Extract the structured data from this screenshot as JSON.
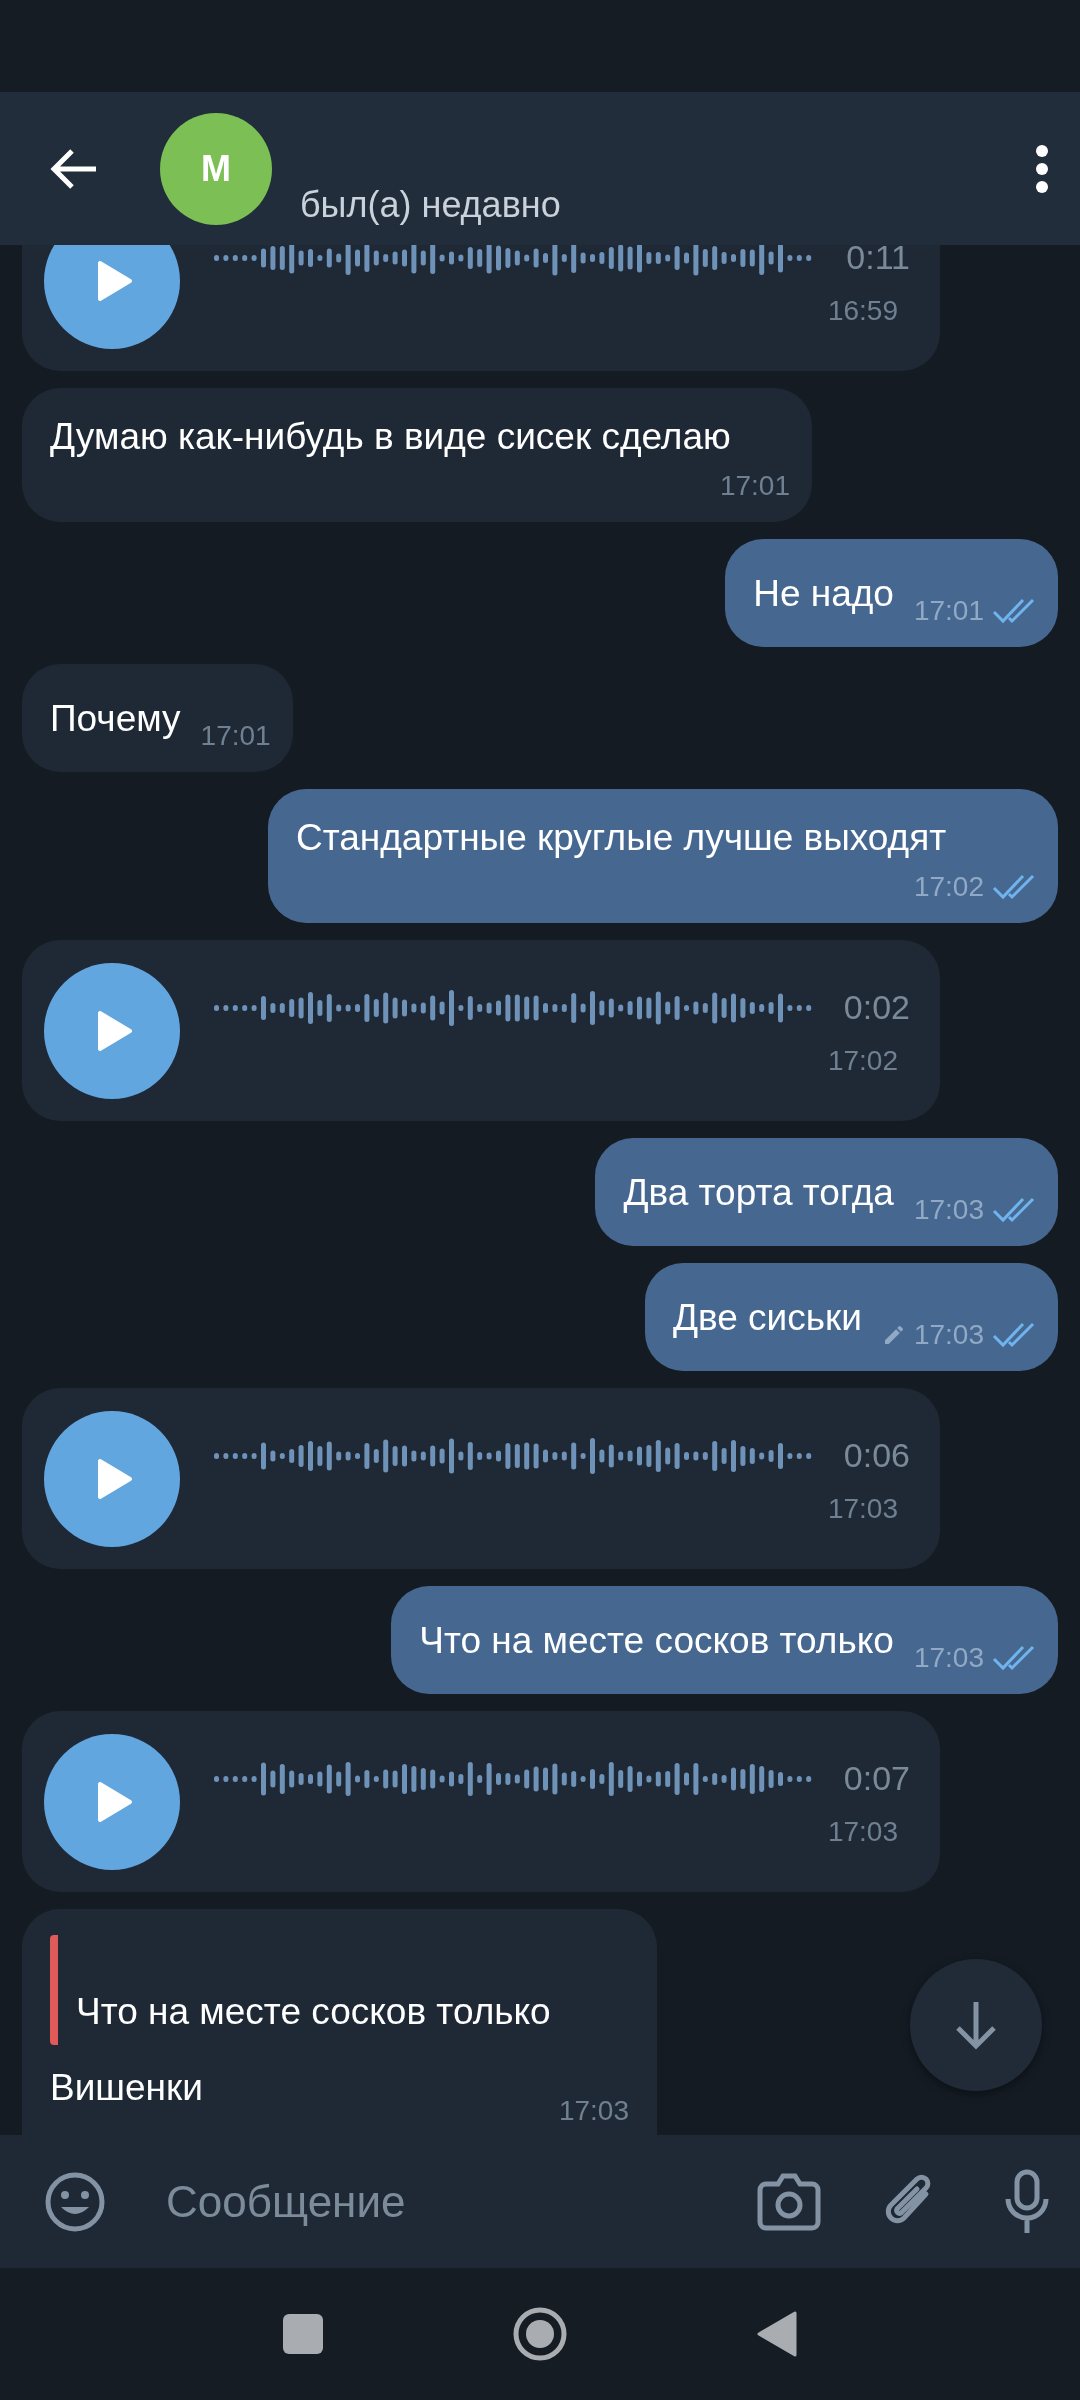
{
  "header": {
    "avatar_letter": "M",
    "status": "был(а) недавно"
  },
  "messages": [
    {
      "kind": "voice",
      "outgoing": false,
      "duration": "0:11",
      "time": "16:59"
    },
    {
      "kind": "text",
      "outgoing": false,
      "text": "Думаю как-нибудь в виде сисек сделаю",
      "time": "17:01"
    },
    {
      "kind": "text",
      "outgoing": true,
      "text": "Не надо",
      "time": "17:01",
      "read": true,
      "edited": false
    },
    {
      "kind": "text",
      "outgoing": false,
      "text": "Почему",
      "time": "17:01"
    },
    {
      "kind": "text",
      "outgoing": true,
      "text": "Стандартные круглые лучше выходят",
      "time": "17:02",
      "read": true,
      "edited": false
    },
    {
      "kind": "voice",
      "outgoing": false,
      "duration": "0:02",
      "time": "17:02"
    },
    {
      "kind": "text",
      "outgoing": true,
      "text": "Два торта тогда",
      "time": "17:03",
      "read": true,
      "edited": false
    },
    {
      "kind": "text",
      "outgoing": true,
      "text": "Две сиськи",
      "time": "17:03",
      "read": true,
      "edited": true
    },
    {
      "kind": "voice",
      "outgoing": false,
      "duration": "0:06",
      "time": "17:03"
    },
    {
      "kind": "text",
      "outgoing": true,
      "text": "Что на месте сосков только",
      "time": "17:03",
      "read": true,
      "edited": false
    },
    {
      "kind": "voice",
      "outgoing": false,
      "duration": "0:07",
      "time": "17:03"
    },
    {
      "kind": "reply",
      "outgoing": false,
      "quote": "Что на месте сосков только",
      "text": "Вишенки",
      "time": "17:03"
    }
  ],
  "composer": {
    "placeholder": "Сообщение"
  }
}
